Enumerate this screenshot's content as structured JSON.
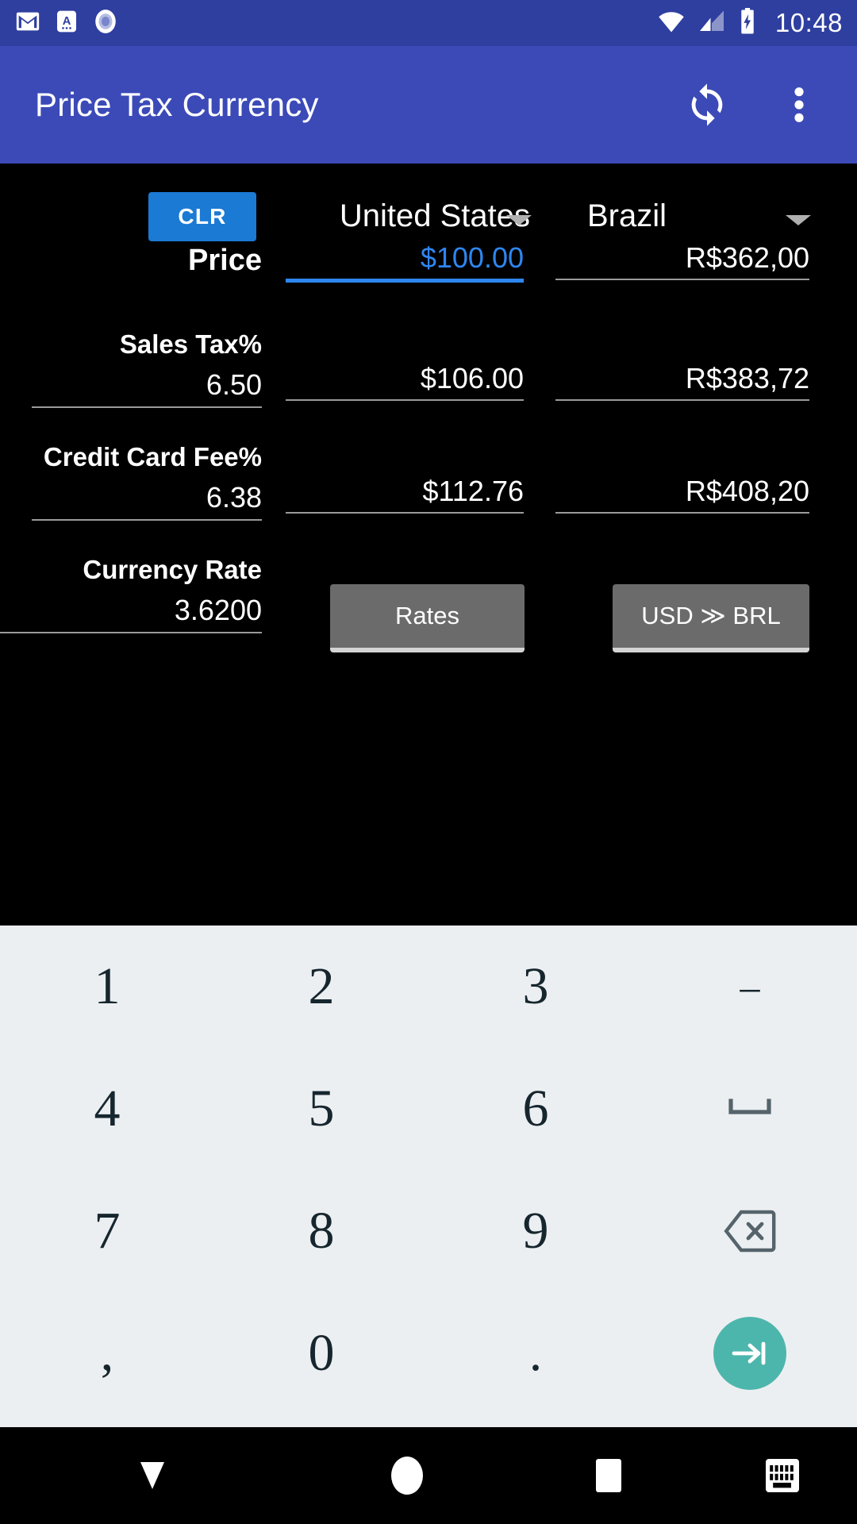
{
  "statusbar": {
    "time": "10:48",
    "left_icons": [
      "gmail-icon",
      "app-a-icon",
      "record-circle-icon"
    ],
    "right_icons": [
      "wifi-icon",
      "cell-signal-icon",
      "battery-charging-icon"
    ],
    "background_color": "#2e3f9f"
  },
  "appbar": {
    "title": "Price Tax Currency",
    "background_color": "#3c4ab8",
    "refresh_icon": "refresh-sync-icon",
    "overflow_icon": "more-vertical-icon"
  },
  "main": {
    "clear_button": "CLR",
    "source_country": "United States",
    "target_country": "Brazil",
    "rows": [
      {
        "label": "Price",
        "input": "",
        "source_value": "$100.00",
        "target_value": "R$362,00",
        "focused": true
      },
      {
        "label": "Sales Tax%",
        "input": "6.50",
        "source_value": "$106.00",
        "target_value": "R$383,72",
        "focused": false
      },
      {
        "label": "Credit Card Fee%",
        "input": "6.38",
        "source_value": "$112.76",
        "target_value": "R$408,20",
        "focused": false
      },
      {
        "label": "Currency Rate",
        "input": "3.6200",
        "source_value": "Rates",
        "target_value": "USD ≫ BRL",
        "focused": false
      }
    ],
    "rates_button": "Rates",
    "pair_button": "USD ≫ BRL",
    "accent_color": "#1b7ad4",
    "focus_color": "#2e86f0",
    "background_color": "#000000"
  },
  "keyboard": {
    "background_color": "#eceff1",
    "key_color": "#16262e",
    "enter_color": "#4db6ac",
    "rows": [
      [
        {
          "label": "1",
          "name": "key-1"
        },
        {
          "label": "2",
          "name": "key-2"
        },
        {
          "label": "3",
          "name": "key-3"
        },
        {
          "label": "–",
          "name": "key-minus"
        }
      ],
      [
        {
          "label": "4",
          "name": "key-4"
        },
        {
          "label": "5",
          "name": "key-5"
        },
        {
          "label": "6",
          "name": "key-6"
        },
        {
          "label": "⌴",
          "name": "key-space"
        }
      ],
      [
        {
          "label": "7",
          "name": "key-7"
        },
        {
          "label": "8",
          "name": "key-8"
        },
        {
          "label": "9",
          "name": "key-9"
        },
        {
          "label": "",
          "name": "key-backspace"
        }
      ],
      [
        {
          "label": ",",
          "name": "key-comma"
        },
        {
          "label": "0",
          "name": "key-0"
        },
        {
          "label": ".",
          "name": "key-period"
        },
        {
          "label": "",
          "name": "key-enter"
        }
      ]
    ]
  },
  "navbar": {
    "back_icon": "collapse-keyboard-icon",
    "home_icon": "home-circle-icon",
    "recents_icon": "recents-square-icon",
    "keyboard_icon": "switch-keyboard-icon",
    "background_color": "#000000"
  }
}
